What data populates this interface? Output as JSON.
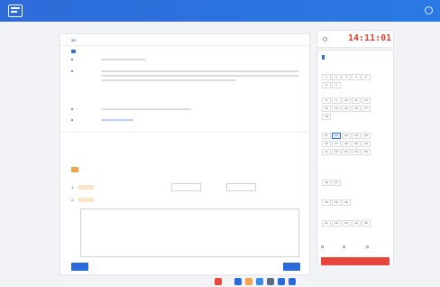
{
  "app": {
    "title": "",
    "user": ""
  },
  "main": {
    "question_info": {
      "label": "",
      "number": "22",
      "suffix": ""
    },
    "background_title": "",
    "background_rows": [
      {
        "label": "",
        "text": ""
      },
      {
        "label": "",
        "text": ""
      },
      {
        "label": "",
        "text": ""
      },
      {
        "label": "",
        "text": ""
      }
    ],
    "answer_title": "",
    "questions": [
      {
        "no": "1.",
        "badge": "",
        "text": "",
        "text_right": "",
        "text_far": ""
      },
      {
        "no": "2.",
        "badge": "",
        "text": ""
      }
    ],
    "prev_label": "",
    "next_label": ""
  },
  "timer": {
    "label": "",
    "value": "14:11:01"
  },
  "answer_card": {
    "title": "",
    "count": "",
    "groups": [
      {
        "title": "",
        "meta": "",
        "items": [
          "1",
          "2",
          "3",
          "4",
          "5",
          "6",
          "7"
        ]
      },
      {
        "title": "",
        "meta": "",
        "items": [
          "8",
          "9",
          "10",
          "11",
          "12",
          "13",
          "14",
          "15",
          "16",
          "17",
          "18"
        ]
      },
      {
        "title": "",
        "meta": "",
        "items": [
          "21",
          "22",
          "23",
          "24",
          "25",
          "26",
          "27",
          "28",
          "29",
          "30",
          "31",
          "32",
          "33",
          "34",
          "35"
        ]
      },
      {
        "title": "",
        "meta": "",
        "items": [
          "36",
          "37"
        ]
      },
      {
        "title": "",
        "meta": "",
        "items": [
          "38",
          "39",
          "40"
        ]
      },
      {
        "title": "",
        "meta": "",
        "items": [
          "41",
          "42",
          "43",
          "44",
          "45"
        ]
      }
    ],
    "current": "22",
    "legend": [
      "",
      "",
      ""
    ],
    "submit_label": ""
  },
  "colors": {
    "primary": "#2a6ad9",
    "timer": "#e0402f",
    "submit": "#e8453c",
    "badge": "#fce5c6"
  }
}
